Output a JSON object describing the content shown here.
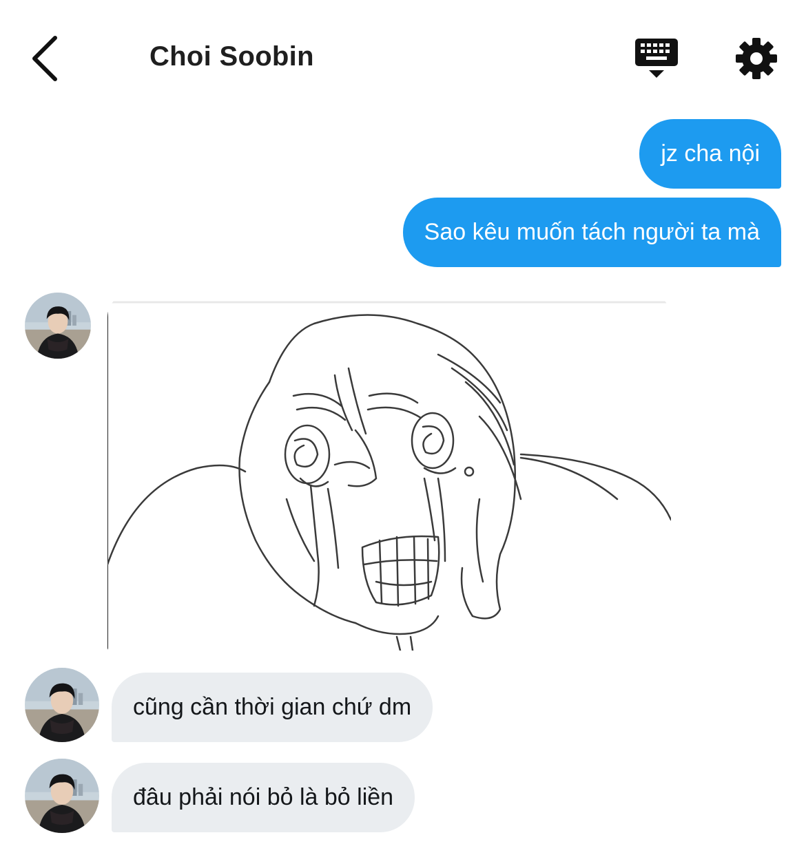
{
  "header": {
    "title": "Choi Soobin",
    "back_icon": "chevron-left-icon",
    "keyboard_icon": "keyboard-icon",
    "settings_icon": "gear-icon"
  },
  "colors": {
    "outgoing_bubble": "#1d9bf0",
    "incoming_bubble": "#eaedf0",
    "title_text": "#1f1f1f"
  },
  "messages": [
    {
      "direction": "outgoing",
      "type": "text",
      "text": "jz cha nội"
    },
    {
      "direction": "outgoing",
      "type": "text",
      "text": "Sao kêu muốn tách người ta mà"
    },
    {
      "direction": "incoming",
      "type": "image",
      "image_desc": "crying-face-sketch"
    },
    {
      "direction": "incoming",
      "type": "text",
      "text": "cũng cần thời gian chứ dm"
    },
    {
      "direction": "incoming",
      "type": "text",
      "text": "đâu phải nói bỏ là bỏ liền"
    }
  ]
}
